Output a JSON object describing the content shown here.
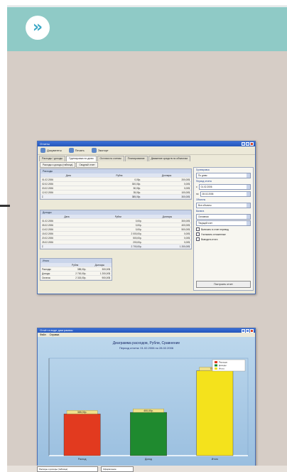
{
  "header": {
    "nav_symbol": "»"
  },
  "window1": {
    "title": "Отчеты",
    "toolbar": [
      "Документы",
      "Печать",
      "Экспорт"
    ],
    "tabs": [
      "Расходы / доходы",
      "Группировка по дням",
      "Остатки по счетам",
      "Планирование",
      "Движение средств по объектам"
    ],
    "subtabs": [
      "Расходы и доходы (таблица)",
      "Сводный отчет"
    ],
    "groups": [
      {
        "title": "Расходы",
        "headers": [
          "Дата",
          "Рубли",
          "Доллары"
        ],
        "rows": [
          [
            "01.02.2006",
            "0,00р.",
            "200,00$"
          ],
          [
            "02.02.2006",
            "300,00р.",
            "0,00$"
          ],
          [
            "03.02.2006",
            "50,00р.",
            "0,00$"
          ],
          [
            "12.02.2006",
            "35,00р.",
            "100,00$"
          ]
        ],
        "total": [
          "Σ",
          "385,00р.",
          "300,00$"
        ]
      },
      {
        "title": "Доходы",
        "headers": [
          "Дата",
          "Рубли",
          "Доллары"
        ],
        "rows": [
          [
            "01.02.2006",
            "0,00р.",
            "300,00$"
          ],
          [
            "05.02.2006",
            "0,00р.",
            "400,00$"
          ],
          [
            "10.02.2006",
            "0,00р.",
            "500,00$"
          ],
          [
            "15.02.2006",
            "2 000,00р.",
            "0,00$"
          ],
          [
            "20.02.2006",
            "500,00р.",
            "0,00$"
          ],
          [
            "25.02.2006",
            "200,00р.",
            "0,00$"
          ]
        ],
        "total": [
          "Σ",
          "2 700,00р.",
          "1 200,00$"
        ]
      },
      {
        "title": "Итого",
        "headers": [
          "",
          "Рубли",
          "Доллары"
        ],
        "rows": [
          [
            "Расходы",
            "385,00р.",
            "300,00$"
          ],
          [
            "Доходы",
            "2 700,00р.",
            "1 200,00$"
          ],
          [
            "Остаток",
            "2 315,00р.",
            "900,00$"
          ]
        ],
        "total": null
      }
    ],
    "right_panel": {
      "section1": "Группировка",
      "combo1": "По дням",
      "section2": "Период отчета",
      "from_label": "с",
      "from_value": "01.02.2006",
      "to_label": "по",
      "to_value": "28.02.2006",
      "section3": "Объекты",
      "combo3": "Все объекты",
      "section4": "Валюта",
      "combo4": "Основная",
      "combo5": "Текущий счет",
      "checks": [
        "Включать в отчет перевод",
        "Учитывать отложенные",
        "Выводить итоги"
      ],
      "button": "Построить отчет"
    }
  },
  "window2": {
    "title": "Отчёт в виде диаграммы",
    "menu": [
      "Файл",
      "Справка"
    ],
    "status_fields": [
      "Расходы и доходы (таблица)",
      "Оформление"
    ]
  },
  "colors": {
    "header": "#8fcac6",
    "background": "#d6cdc6",
    "bar_red": "#e23a1f",
    "bar_green": "#1f8a2f",
    "bar_yellow": "#f4e21c"
  },
  "chart_data": {
    "type": "bar",
    "title": "Диаграмма расходов, Рубли, Сравнение",
    "subtitle": "Период отчета: 01.02.2006 по 28.02.2006",
    "categories": [
      "Расход",
      "Доход",
      "Итого"
    ],
    "values": [
      385,
      400,
      785
    ],
    "data_labels": [
      "385,00р.",
      "400,00р.",
      "785,00р."
    ],
    "legend": [
      "Расходы",
      "Доходы",
      "Итого"
    ],
    "legend_position": "top-right",
    "ylim": [
      0,
      900
    ],
    "grid": false
  }
}
